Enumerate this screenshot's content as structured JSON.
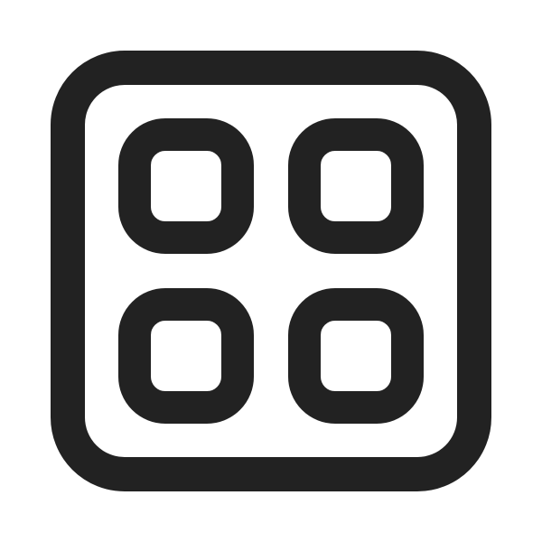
{
  "icon": {
    "name": "apps-grid-icon",
    "color": "#222222",
    "background": "#ffffff"
  }
}
